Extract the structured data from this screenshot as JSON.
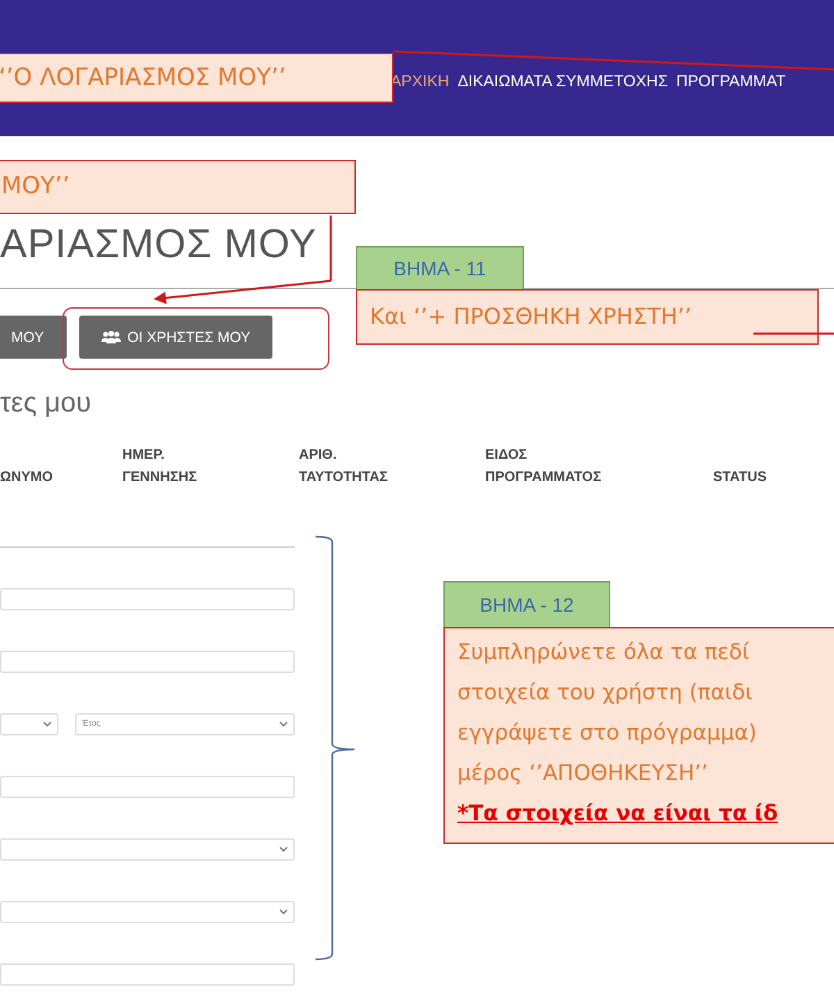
{
  "header": {
    "nav": [
      {
        "label": "ΑΡΧΙΚΗ",
        "selected": true
      },
      {
        "label": "ΔΙΚΑΙΩΜΑΤΑ ΣΥΜΜΕΤΟΧΗΣ",
        "selected": false
      },
      {
        "label": "ΠΡΟΓΡΑΜΜΑΤ",
        "selected": false
      }
    ]
  },
  "page": {
    "title": "ΑΡΙΑΣΜΟΣ ΜΟΥ",
    "buttons": [
      {
        "label": "ΜΟΥ",
        "kind": "plain"
      },
      {
        "label": "ΟΙ ΧΡΗΣΤΕΣ ΜΟΥ",
        "kind": "users"
      }
    ],
    "subheading": "τες μου",
    "table": {
      "columns": [
        "ΩΝΥΜΟ",
        "ΗΜΕΡ. ΓΕΝΝΗΣΗΣ",
        "ΑΡΙΘ. ΤΑΥΤΟΤΗΤΑΣ",
        "ΕΙΔΟΣ ΠΡΟΓΡΑΜΜΑΤΟΣ",
        "STATUS"
      ]
    },
    "form": {
      "fields": [
        {
          "kind": "input"
        },
        {
          "kind": "input"
        },
        {
          "kind": "date",
          "placeholder": "Έτος"
        },
        {
          "kind": "input"
        },
        {
          "kind": "select"
        },
        {
          "kind": "select"
        },
        {
          "kind": "input"
        }
      ]
    }
  },
  "annotations": {
    "callouts": [
      "‘’Ο ΛΟΓΑΡΙΑΣΜΟΣ ΜΟΥ’’",
      "ΜΟΥ’’"
    ],
    "step_11": {
      "label": "ΒΗΜΑ - 11",
      "text": "Και ‘’+ ΠΡΟΣΘΗΚΗ ΧΡΗΣΤΗ’’"
    },
    "step_12": {
      "label": "ΒΗΜΑ - 12",
      "lines": [
        {
          "text": "Συμπληρώνετε όλα τα πεδί",
          "kind": "note"
        },
        {
          "text": "στοιχεία του χρήστη (παιδι",
          "kind": "note"
        },
        {
          "text": "εγγράψετε στο πρόγραμμα)",
          "kind": "note"
        },
        {
          "text": "μέρος ‘’ΑΠΟΘΗΚΕΥΣΗ’’",
          "kind": "note"
        },
        {
          "text": "*Τα στοιχεία να είναι τα ίδ",
          "kind": "warning"
        }
      ]
    }
  }
}
